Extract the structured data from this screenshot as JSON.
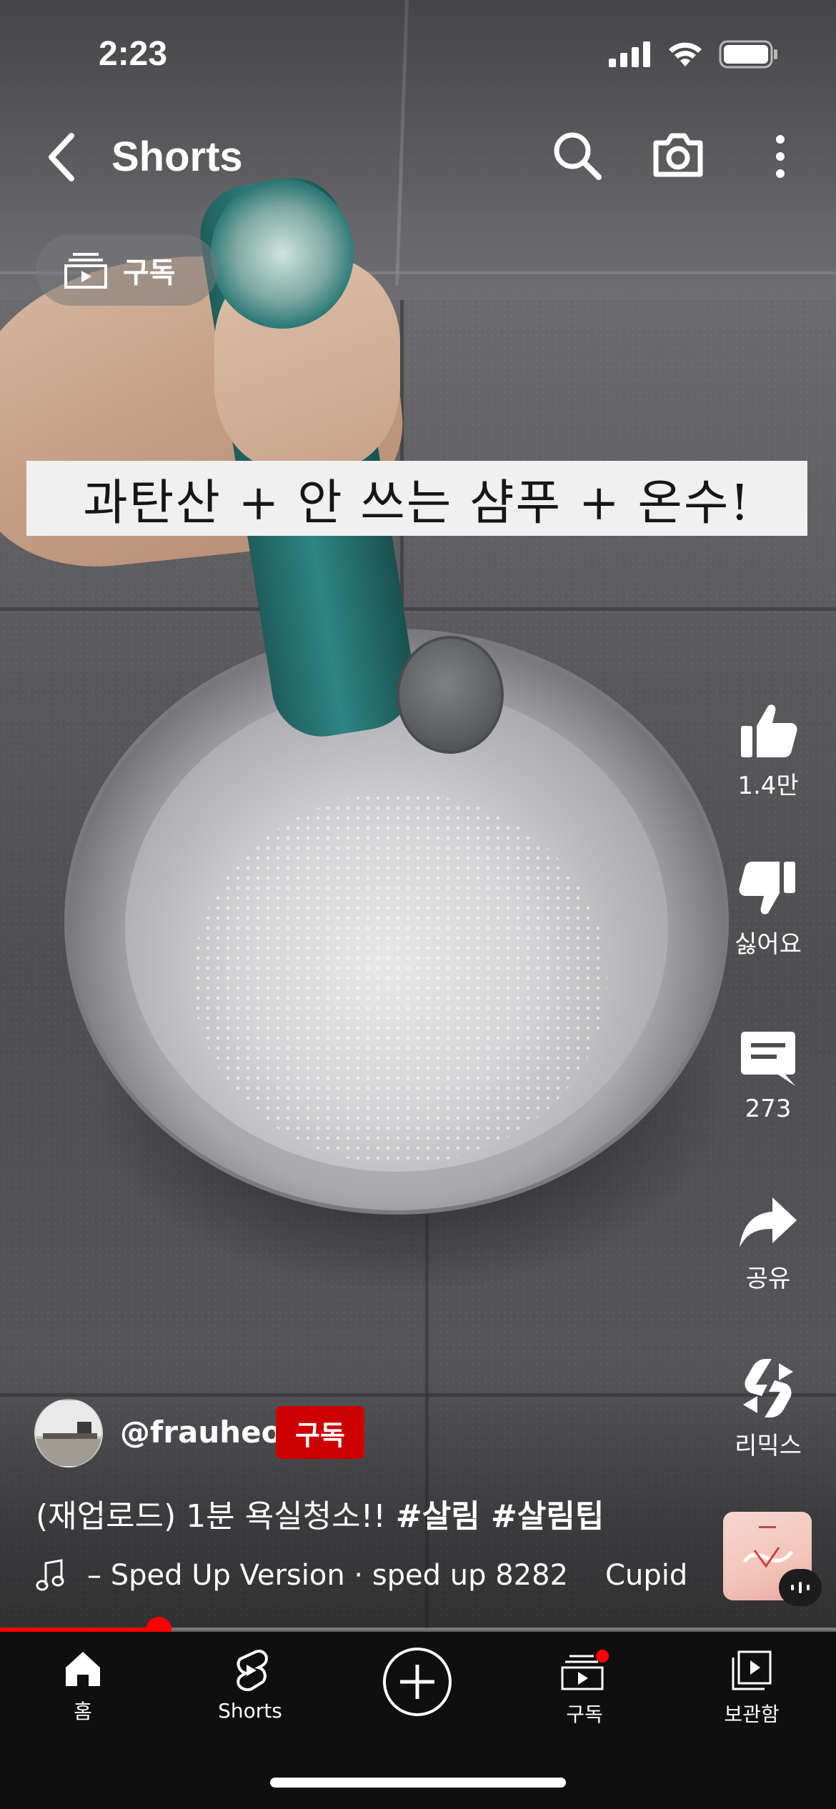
{
  "status_bar": {
    "time": "2:23"
  },
  "header": {
    "title": "Shorts"
  },
  "subscriptions_chip": {
    "label": "구독"
  },
  "video": {
    "overlay_caption": "과탄산 + 안 쓰는 샴푸 + 온수!"
  },
  "actions": {
    "like": {
      "label": "1.4만",
      "icon": "thumbs-up-icon"
    },
    "dislike": {
      "label": "싫어요",
      "icon": "thumbs-down-icon"
    },
    "comments": {
      "label": "273",
      "icon": "comment-icon"
    },
    "share": {
      "label": "공유",
      "icon": "share-icon"
    },
    "remix": {
      "label": "리믹스",
      "icon": "remix-icon"
    }
  },
  "channel": {
    "handle": "@frauheo",
    "subscribe_label": "구독"
  },
  "video_title": {
    "text": "(재업로드) 1분 욕실청소!! ",
    "hashtags": "#살림 #살림팁"
  },
  "music": {
    "track": "– Sped Up Version · sped up 8282",
    "artist": "Cupid"
  },
  "progress": {
    "fraction": 0.19
  },
  "bottom_nav": {
    "home": "홈",
    "shorts": "Shorts",
    "subscriptions": "구독",
    "library": "보관함"
  },
  "colors": {
    "accent": "#ff0000",
    "subscribe": "#cc0000",
    "background": "#0f0f0f"
  }
}
